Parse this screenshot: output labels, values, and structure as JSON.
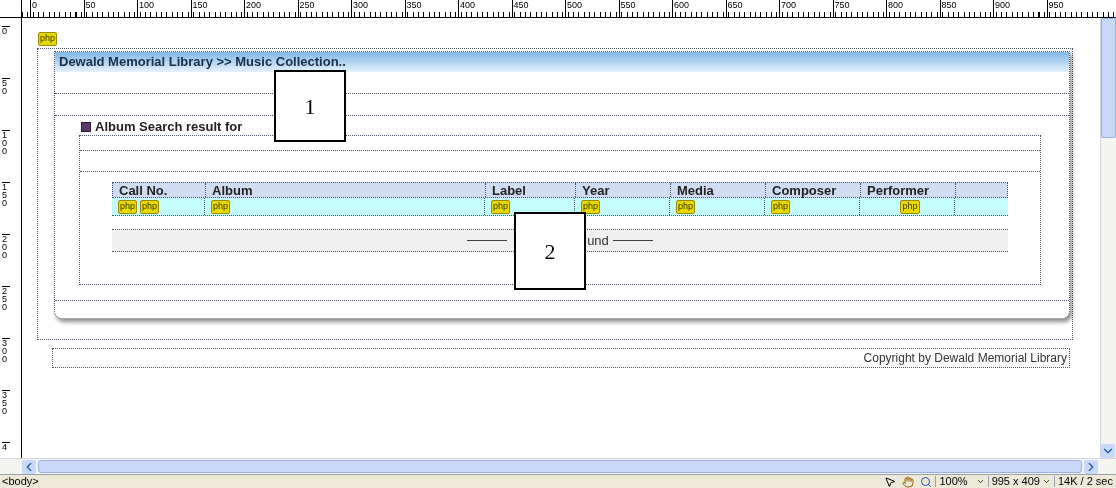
{
  "rulers": {
    "horizontal": [
      "0",
      "50",
      "100",
      "150",
      "200",
      "250",
      "300",
      "350",
      "400",
      "450",
      "500",
      "550",
      "600",
      "650",
      "700",
      "750",
      "800",
      "850",
      "900",
      "950"
    ],
    "vertical": [
      "0",
      "50",
      "100",
      "150",
      "200",
      "250",
      "300",
      "350",
      "4"
    ]
  },
  "document": {
    "tag": "php",
    "header": "Dewald Memorial Library >> Music Collection..",
    "search_heading": "Album Search result for",
    "table": {
      "columns": [
        "Call No.",
        "Album",
        "Label",
        "Year",
        "Media",
        "Composer",
        "Performer"
      ],
      "row": [
        [
          "php",
          "php"
        ],
        [
          "php"
        ],
        [
          "php"
        ],
        [
          "php"
        ],
        [
          "php"
        ],
        [
          "php"
        ],
        [
          "php"
        ]
      ]
    },
    "empty_message": "und",
    "footer": "Copyright by Dewald Memorial Library"
  },
  "callouts": [
    "1",
    "2"
  ],
  "status_bar": {
    "tag": "<body>",
    "zoom": "100%",
    "size": "995 x 409",
    "speed": "14K / 2 sec"
  }
}
